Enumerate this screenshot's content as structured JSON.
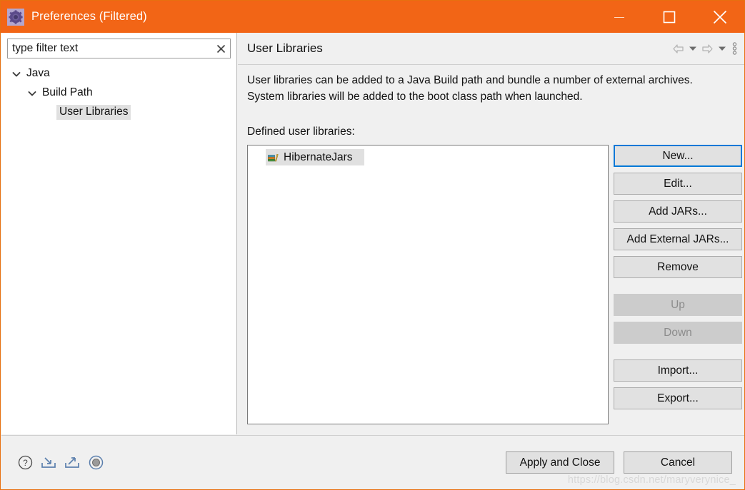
{
  "window": {
    "title": "Preferences (Filtered)",
    "icon": "gear-icon",
    "accent_color": "#f26516",
    "controls": {
      "minimize": "minimize-icon",
      "maximize": "maximize-icon",
      "close": "close-icon"
    }
  },
  "sidebar": {
    "filter": {
      "value": "type filter text",
      "placeholder": "type filter text",
      "clear_icon": "clear-icon"
    },
    "tree": [
      {
        "label": "Java",
        "level": 0,
        "expanded": true,
        "selected": false
      },
      {
        "label": "Build Path",
        "level": 1,
        "expanded": true,
        "selected": false
      },
      {
        "label": "User Libraries",
        "level": 2,
        "expanded": false,
        "selected": true
      }
    ]
  },
  "panel": {
    "title": "User Libraries",
    "tools": [
      {
        "name": "back-arrow-icon"
      },
      {
        "name": "back-dropdown-caret-icon"
      },
      {
        "name": "forward-arrow-icon"
      },
      {
        "name": "forward-dropdown-caret-icon"
      },
      {
        "name": "view-menu-icon"
      }
    ],
    "description": "User libraries can be added to a Java Build path and bundle a number of external archives. System libraries will be added to the boot class path when launched.",
    "list_label": "Defined user libraries:",
    "libraries": [
      {
        "name": "HibernateJars",
        "icon": "library-icon",
        "selected": true
      }
    ],
    "buttons": [
      {
        "label": "New...",
        "enabled": true,
        "focused": true
      },
      {
        "label": "Edit...",
        "enabled": true,
        "focused": false
      },
      {
        "label": "Add JARs...",
        "enabled": true,
        "focused": false
      },
      {
        "label": "Add External JARs...",
        "enabled": true,
        "focused": false
      },
      {
        "label": "Remove",
        "enabled": true,
        "focused": false
      },
      {
        "label": "Up",
        "enabled": false,
        "focused": false
      },
      {
        "label": "Down",
        "enabled": false,
        "focused": false
      },
      {
        "label": "Import...",
        "enabled": true,
        "focused": false
      },
      {
        "label": "Export...",
        "enabled": true,
        "focused": false
      }
    ]
  },
  "footer": {
    "icons": [
      {
        "name": "help-icon"
      },
      {
        "name": "import-preferences-icon"
      },
      {
        "name": "export-preferences-icon"
      },
      {
        "name": "restore-defaults-icon"
      }
    ],
    "apply_label": "Apply and Close",
    "cancel_label": "Cancel",
    "watermark": "https://blog.csdn.net/maryverynice_"
  },
  "colors": {
    "title_bar": "#f26516",
    "focus_border": "#0078d7",
    "panel_bg": "#f0f0f0",
    "selection": "#e0e0e0"
  }
}
